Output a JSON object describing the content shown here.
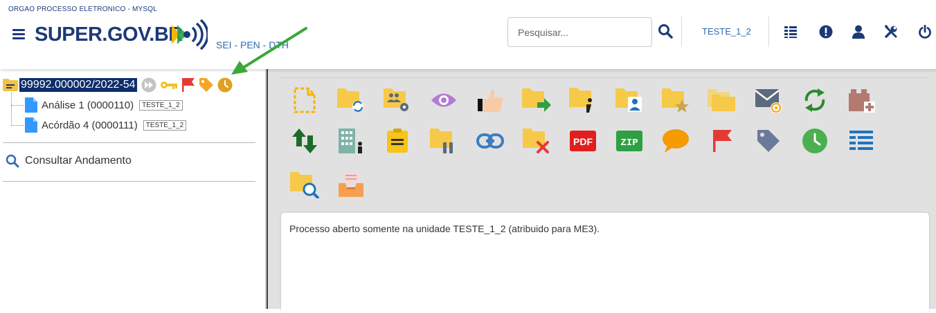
{
  "header": {
    "org_name": "ORGAO PROCESSO ELETRONICO - MYSQL",
    "logo_text": "SUPER.GOV.BR",
    "sistema": "SEI - PEN - DTH",
    "search_placeholder": "Pesquisar...",
    "unit": "TESTE_1_2",
    "icons": [
      "search-icon",
      "list-icon",
      "alert-icon",
      "user-icon",
      "tools-icon",
      "power-icon"
    ],
    "accent_color": "#1c3a78"
  },
  "tree": {
    "process_number": "99992.000002/2022-54",
    "documents": [
      {
        "label": "Análise 1 (0000110)",
        "unit": "TESTE_1_2"
      },
      {
        "label": "Acórdão 4 (0000111)",
        "unit": "TESTE_1_2"
      }
    ],
    "consultar_andamento": "Consultar Andamento"
  },
  "toolbar": {
    "pdf_label": "PDF",
    "zip_label": "ZIP",
    "icons": [
      "new-document-icon",
      "reopen-process-icon",
      "process-settings-icon",
      "view-icon",
      "sign-approve-icon",
      "send-process-icon",
      "process-info-icon",
      "assign-user-icon",
      "favorite-process-icon",
      "related-processes-icon",
      "send-email-icon",
      "sync-icon",
      "add-block-icon",
      "move-icon",
      "organization-icon",
      "note-icon",
      "suspend-process-icon",
      "link-icon",
      "cancel-process-icon",
      "pdf-icon",
      "zip-icon",
      "comment-icon",
      "flag-icon",
      "tag-icon",
      "clock-icon",
      "list-icon",
      "search-process-icon",
      "archive-icon"
    ]
  },
  "message": {
    "text": "Processo aberto somente na unidade TESTE_1_2 (atribuido para ME3)."
  }
}
